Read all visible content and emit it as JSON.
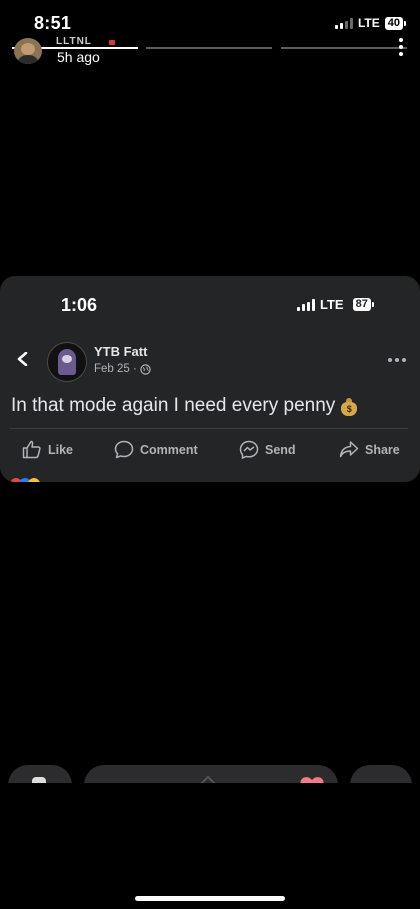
{
  "status_bar": {
    "time": "8:51",
    "network": "LTE",
    "battery": "40"
  },
  "story": {
    "time_ago": "5h ago",
    "name_fragment": "LLTNL"
  },
  "embedded": {
    "status_bar": {
      "time": "1:06",
      "network": "LTE",
      "battery": "87"
    },
    "post": {
      "author": "YTB Fatt",
      "date": "Feb 25 ·",
      "text": "In that mode again I need every penny",
      "emoji": "money-bag",
      "actions": {
        "like": "Like",
        "comment": "Comment",
        "send": "Send",
        "share": "Share"
      }
    }
  },
  "colors": {
    "card_bg": "#242526",
    "text_primary": "#e4e6eb",
    "text_secondary": "#b0b3b8"
  }
}
